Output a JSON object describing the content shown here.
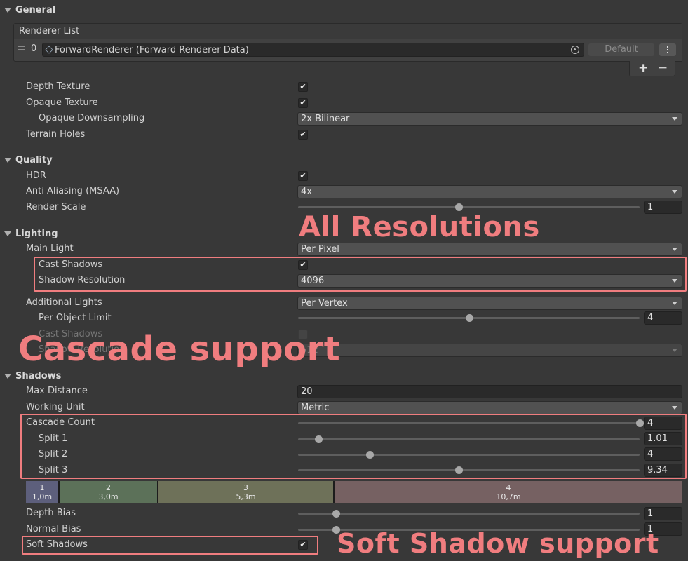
{
  "general": {
    "title": "General",
    "renderer_list": {
      "title": "Renderer List",
      "index": "0",
      "renderer": "ForwardRenderer (Forward Renderer Data)",
      "default_label": "Default",
      "add_label": "+",
      "remove_label": "−"
    },
    "depth_texture": {
      "label": "Depth Texture",
      "checked": true
    },
    "opaque_texture": {
      "label": "Opaque Texture",
      "checked": true
    },
    "opaque_downsampling": {
      "label": "Opaque Downsampling",
      "value": "2x Bilinear"
    },
    "terrain_holes": {
      "label": "Terrain Holes",
      "checked": true
    }
  },
  "quality": {
    "title": "Quality",
    "hdr": {
      "label": "HDR",
      "checked": true
    },
    "anti_aliasing": {
      "label": "Anti Aliasing (MSAA)",
      "value": "4x"
    },
    "render_scale": {
      "label": "Render Scale",
      "value": "1",
      "slider_fraction": 0.47
    }
  },
  "lighting": {
    "title": "Lighting",
    "main_light": {
      "label": "Main Light",
      "value": "Per Pixel"
    },
    "cast_shadows": {
      "label": "Cast Shadows",
      "checked": true
    },
    "shadow_resolution": {
      "label": "Shadow Resolution",
      "value": "4096"
    },
    "additional_lights": {
      "label": "Additional Lights",
      "value": "Per Vertex"
    },
    "per_object_limit": {
      "label": "Per Object Limit",
      "value": "4",
      "slider_fraction": 0.5
    },
    "additional_cast_shadows": {
      "label": "Cast Shadows",
      "checked": false,
      "disabled": true
    },
    "additional_shadow_resolution": {
      "label": "Shadow Resolution",
      "value": "512",
      "disabled": true
    }
  },
  "shadows": {
    "title": "Shadows",
    "max_distance": {
      "label": "Max Distance",
      "value": "20"
    },
    "working_unit": {
      "label": "Working Unit",
      "value": "Metric"
    },
    "cascade_count": {
      "label": "Cascade Count",
      "value": "4",
      "slider_fraction": 1.0
    },
    "split1": {
      "label": "Split 1",
      "value": "1.01",
      "slider_fraction": 0.06
    },
    "split2": {
      "label": "Split 2",
      "value": "4",
      "slider_fraction": 0.21
    },
    "split3": {
      "label": "Split 3",
      "value": "9.34",
      "slider_fraction": 0.47
    },
    "cascades": [
      {
        "index": "1",
        "distance": "1,0m",
        "color": "#5d5f7c"
      },
      {
        "index": "2",
        "distance": "3,0m",
        "color": "#5c7159"
      },
      {
        "index": "3",
        "distance": "5,3m",
        "color": "#6e7159"
      },
      {
        "index": "4",
        "distance": "10,7m",
        "color": "#766162"
      }
    ],
    "depth_bias": {
      "label": "Depth Bias",
      "value": "1",
      "slider_fraction": 0.11
    },
    "normal_bias": {
      "label": "Normal Bias",
      "value": "1",
      "slider_fraction": 0.11
    },
    "soft_shadows": {
      "label": "Soft Shadows",
      "checked": true
    }
  },
  "annotations": {
    "all_resolutions": "All Resolutions",
    "cascade_support": "Cascade support",
    "soft_shadow_support": "Soft Shadow support",
    "color": "#f07d7f"
  },
  "icons": {
    "check": "✔",
    "renderer_asset": "cube-icon",
    "object_picker": "target-icon",
    "kebab": "kebab-icon",
    "drag_handle": "drag-handle-icon"
  }
}
